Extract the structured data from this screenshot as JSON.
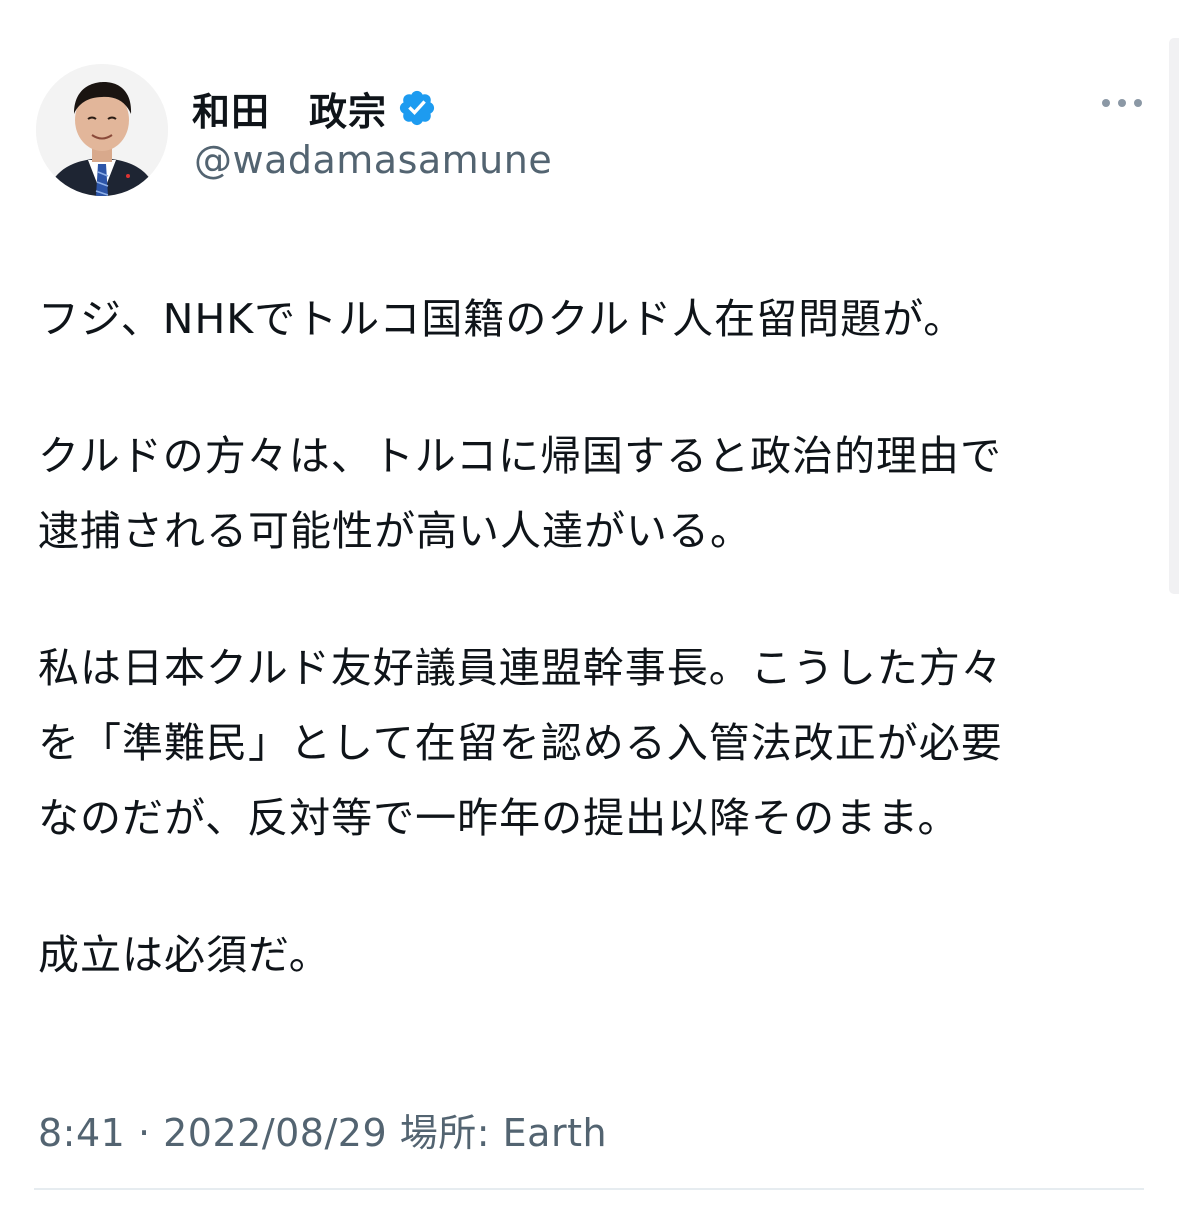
{
  "tweet": {
    "author": {
      "display_name": "和田　政宗",
      "handle": "@wadamasamune",
      "avatar_icon": "profile-photo",
      "verified_icon": "verified-badge-icon",
      "verified_color": "#1d9bf0"
    },
    "more_icon": "more-horizontal-icon",
    "paragraphs": [
      {
        "lines": [
          "フジ、NHKでトルコ国籍のクルド人在留問題が。"
        ]
      },
      {
        "lines": [
          "クルドの方々は、トルコに帰国すると政治的理由で",
          "逮捕される可能性が高い人達がいる。"
        ]
      },
      {
        "lines": [
          "私は日本クルド友好議員連盟幹事長。こうした方々",
          "を「準難民」として在留を認める入管法改正が必要",
          "なのだが、反対等で一昨年の提出以降そのまま。"
        ]
      },
      {
        "lines": [
          "成立は必須だ。"
        ]
      }
    ],
    "time": "8:41",
    "separator": "·",
    "date": "2022/08/29",
    "location_label": "場所:",
    "location": "Earth"
  }
}
